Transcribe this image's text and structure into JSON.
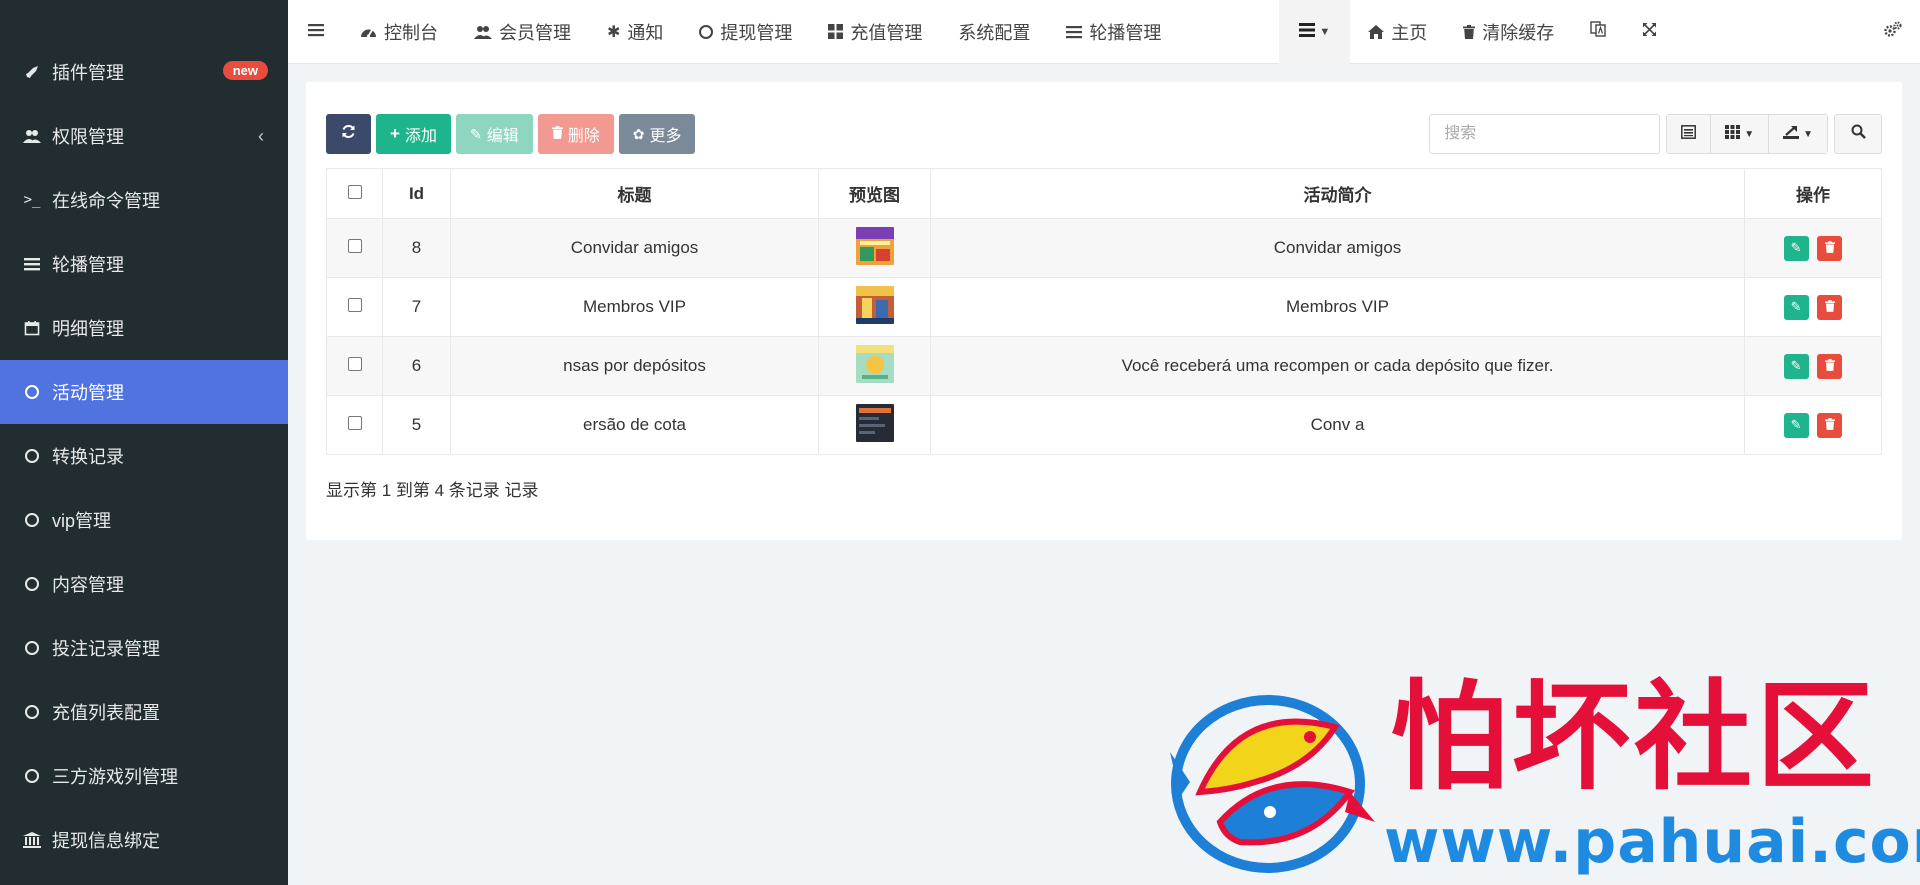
{
  "sidebar": {
    "items": [
      {
        "label": "插件管理",
        "icon": "rocket-icon",
        "badge": "new"
      },
      {
        "label": "权限管理",
        "icon": "users-icon",
        "arrow": "‹"
      },
      {
        "label": "在线命令管理",
        "icon": "terminal-icon"
      },
      {
        "label": "轮播管理",
        "icon": "list-icon"
      },
      {
        "label": "明细管理",
        "icon": "calendar-icon"
      },
      {
        "label": "活动管理",
        "icon": "circle-icon",
        "active": true
      },
      {
        "label": "转换记录",
        "icon": "circle-icon"
      },
      {
        "label": "vip管理",
        "icon": "circle-icon"
      },
      {
        "label": "内容管理",
        "icon": "circle-icon"
      },
      {
        "label": "投注记录管理",
        "icon": "circle-icon"
      },
      {
        "label": "充值列表配置",
        "icon": "circle-icon"
      },
      {
        "label": "三方游戏列管理",
        "icon": "circle-icon"
      },
      {
        "label": "提现信息绑定",
        "icon": "bank-icon"
      }
    ]
  },
  "topnav": {
    "tabs": [
      {
        "label": "控制台",
        "icon": "dashboard-icon"
      },
      {
        "label": "会员管理",
        "icon": "users-icon"
      },
      {
        "label": "通知",
        "icon": "asterisk-icon"
      },
      {
        "label": "提现管理",
        "icon": "circle-icon"
      },
      {
        "label": "充值管理",
        "icon": "grid-icon"
      },
      {
        "label": "系统配置",
        "icon": ""
      },
      {
        "label": "轮播管理",
        "icon": "list-icon"
      }
    ],
    "home_label": "主页",
    "clear_cache_label": "清除缓存"
  },
  "toolbar": {
    "add_label": "添加",
    "edit_label": "编辑",
    "delete_label": "删除",
    "more_label": "更多"
  },
  "search": {
    "placeholder": "搜索"
  },
  "table": {
    "headers": [
      "Id",
      "标题",
      "预览图",
      "活动简介",
      "操作"
    ],
    "rows": [
      {
        "id": "8",
        "title": "Convidar amigos",
        "desc": "Convidar amigos",
        "thumb_color": "#e0a030"
      },
      {
        "id": "7",
        "title": "Membros VIP",
        "desc": "Membros VIP",
        "thumb_color": "#c0603a"
      },
      {
        "id": "6",
        "title": "nsas por depósitos",
        "desc": "Você receberá uma recompen or cada depósito que fizer.",
        "thumb_color": "#9bd3b5"
      },
      {
        "id": "5",
        "title": "ersão de cota",
        "desc": "Conv a",
        "thumb_color": "#2a2f3a"
      }
    ]
  },
  "pager": {
    "info": "显示第 1 到第 4 条记录 记录"
  },
  "watermark": {
    "text": "怕坏社区",
    "url": "www.pahuai.com"
  },
  "colors": {
    "sidebar_bg": "#222d32",
    "active": "#5173e0",
    "success": "#1fb58c",
    "danger": "#e74c3c"
  }
}
